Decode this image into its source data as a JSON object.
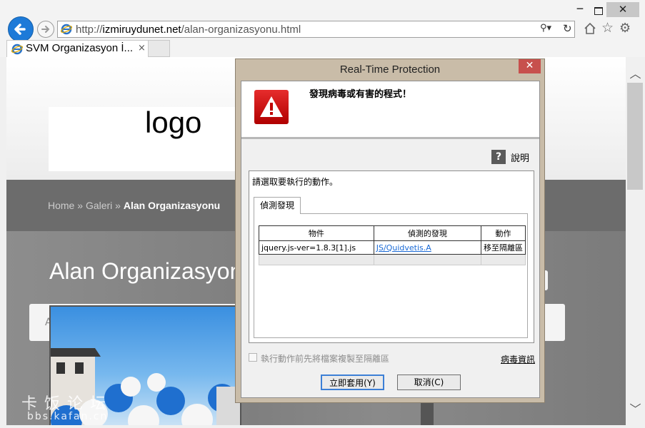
{
  "browser": {
    "url_prefix": "http://",
    "url_host": "izmiruydunet.net",
    "url_path": "/alan-organizasyonu.html",
    "tab_title": "SVM Organizasyon İ...",
    "tab_close": "×",
    "window_min": "─",
    "window_close": "✕"
  },
  "page": {
    "logo": "logo",
    "breadcrumb": {
      "home": "Home",
      "sep1": " » ",
      "galeri": "Galeri",
      "sep2": " » ",
      "current": "Alan Organizasyonu"
    },
    "heading": "Alan Organizasyonu",
    "card_letter": "A"
  },
  "dialog": {
    "title": "Real-Time Protection",
    "close": "✕",
    "headline": "發現病毒或有害的程式！",
    "help": "說明",
    "prompt": "請選取要執行的動作。",
    "tab": "偵測發現",
    "table": {
      "headers": [
        "物件",
        "偵測的發現",
        "動作"
      ],
      "rows": [
        {
          "object": "jquery.js-ver=1.8.3[1].js",
          "detection": "JS/Quidvetis.A",
          "action": "移至隔離區"
        }
      ]
    },
    "copy_checkbox": {
      "label": "執行動作前先將檔案複製至隔離區",
      "checked": false,
      "enabled": false
    },
    "virus_info": "病毒資訊",
    "apply": "立即套用(Y)",
    "cancel": "取消(C)"
  },
  "watermark": {
    "line1": "卡饭论坛",
    "line2": "bbs.kafan.cn"
  },
  "colors": {
    "accent": "#1d7ad8",
    "dialog_frame": "#c9bca8",
    "warning_red": "#d40000",
    "link": "#1a6ad6"
  }
}
